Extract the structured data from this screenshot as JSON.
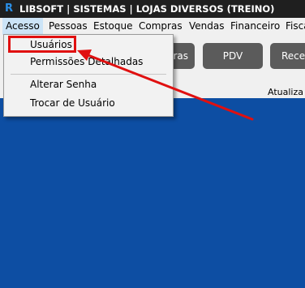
{
  "window": {
    "title": "LIBSOFT | SISTEMAS | LOJAS DIVERSOS (TREINO)",
    "icon": "R"
  },
  "menubar": {
    "items": [
      "Acesso",
      "Pessoas",
      "Estoque",
      "Compras",
      "Vendas",
      "Financeiro",
      "Fisca"
    ]
  },
  "dropdown": {
    "items": [
      "Usuários",
      "Permissões Detalhadas",
      "Alterar Senha",
      "Trocar de Usuário"
    ]
  },
  "toolbar": {
    "buttons": [
      "ras",
      "PDV",
      "Receb"
    ],
    "status": "Atualiza"
  },
  "colors": {
    "desktop": "#0d4ea3",
    "titlebar": "#1f1f1f",
    "annotation": "#e01010",
    "button": "#5b5b5b"
  }
}
